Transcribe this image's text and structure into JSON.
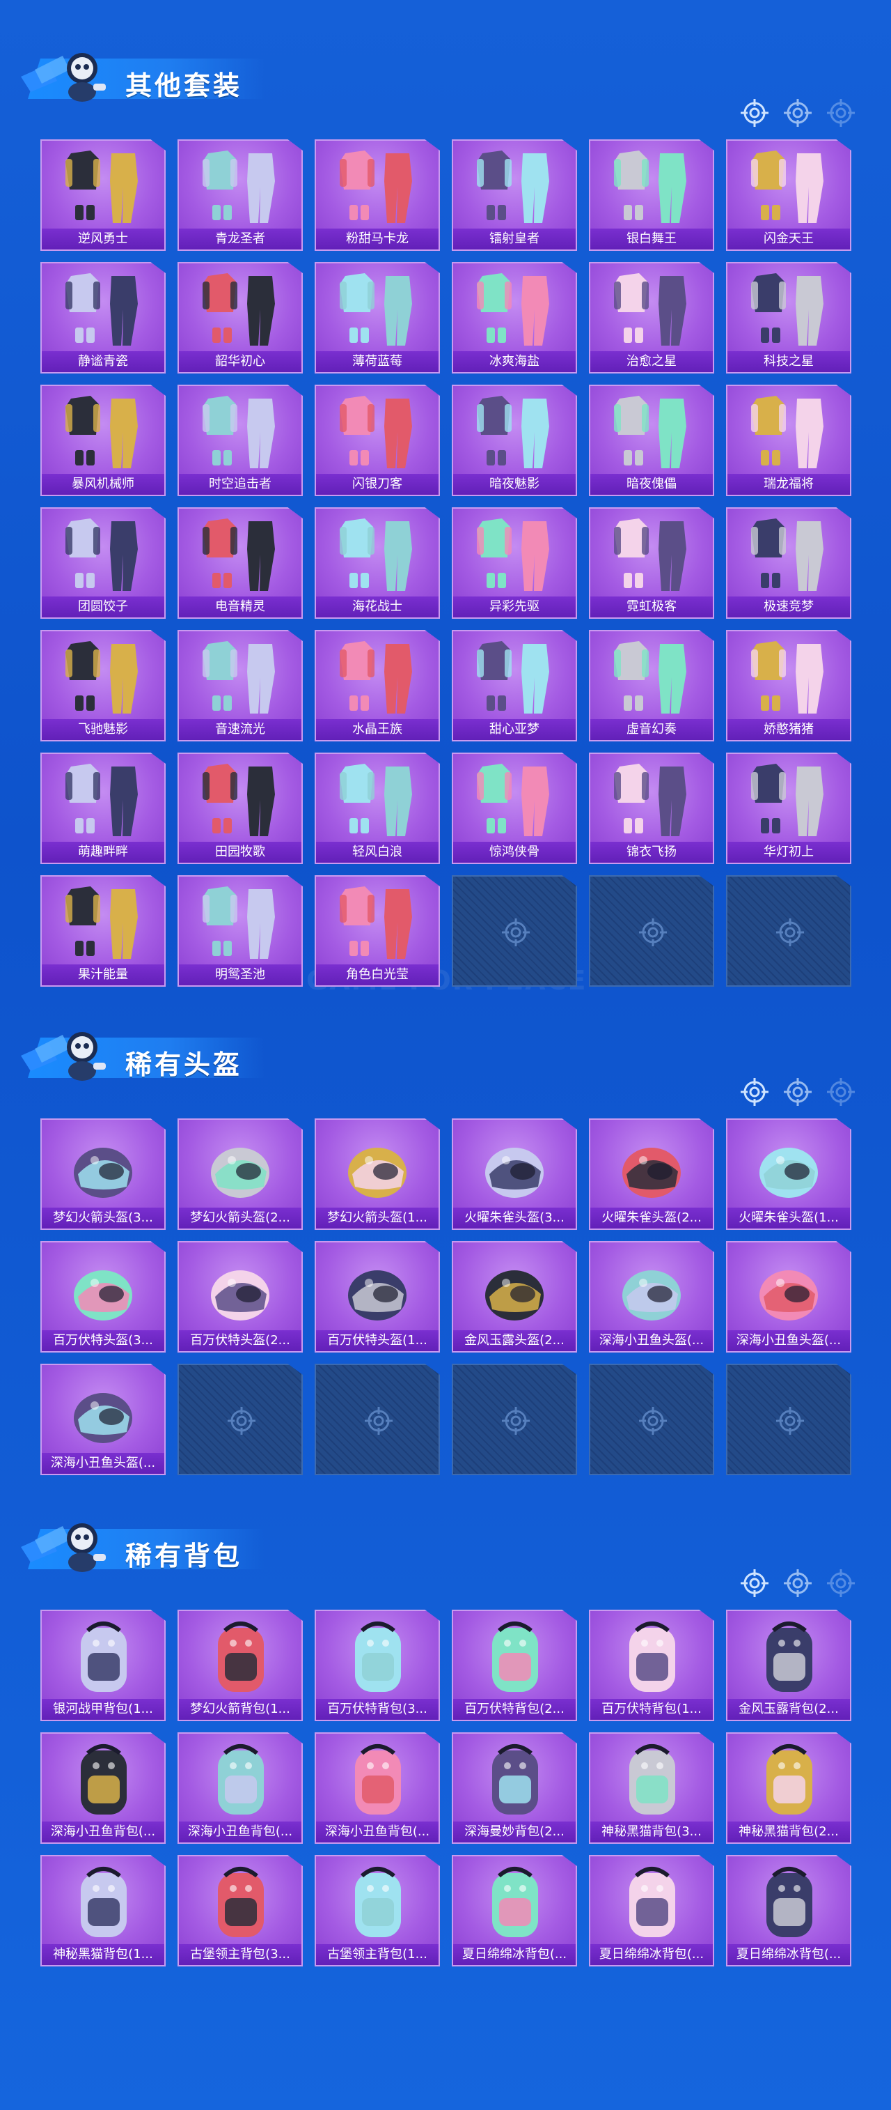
{
  "watermark": "GAME FOR PEACE",
  "sections": [
    {
      "title": "其他套装",
      "kind": "outfit",
      "items": [
        "逆风勇士",
        "青龙圣者",
        "粉甜马卡龙",
        "镭射皇者",
        "银白舞王",
        "闪金天王",
        "静谧青瓷",
        "韶华初心",
        "薄荷蓝莓",
        "冰爽海盐",
        "治愈之星",
        "科技之星",
        "暴风机械师",
        "时空追击者",
        "闪银刀客",
        "暗夜魅影",
        "暗夜傀儡",
        "瑞龙福将",
        "团圆饺子",
        "电音精灵",
        "海花战士",
        "异彩先驱",
        "霓虹极客",
        "极速竞梦",
        "飞驰魅影",
        "音速流光",
        "水晶王族",
        "甜心亚梦",
        "虚音幻奏",
        "娇憨猪猪",
        "萌趣畔畔",
        "田园牧歌",
        "轻风白浪",
        "惊鸿侠骨",
        "锦衣飞扬",
        "华灯初上",
        "果汁能量",
        "明鸳圣池",
        "角色白光莹"
      ],
      "empty_slots": 3
    },
    {
      "title": "稀有头盔",
      "kind": "helmet",
      "items": [
        "梦幻火箭头盔(3...",
        "梦幻火箭头盔(2...",
        "梦幻火箭头盔(1...",
        "火曜朱雀头盔(3...",
        "火曜朱雀头盔(2...",
        "火曜朱雀头盔(1...",
        "百万伏特头盔(3...",
        "百万伏特头盔(2...",
        "百万伏特头盔(1...",
        "金风玉露头盔(2...",
        "深海小丑鱼头盔(...",
        "深海小丑鱼头盔(...",
        "深海小丑鱼头盔(..."
      ],
      "empty_slots": 5
    },
    {
      "title": "稀有背包",
      "kind": "backpack",
      "items": [
        "银河战甲背包(1...",
        "梦幻火箭背包(1...",
        "百万伏特背包(3...",
        "百万伏特背包(2...",
        "百万伏特背包(1...",
        "金风玉露背包(2...",
        "深海小丑鱼背包(...",
        "深海小丑鱼背包(...",
        "深海小丑鱼背包(...",
        "深海曼妙背包(2...",
        "神秘黑猫背包(3...",
        "神秘黑猫背包(2...",
        "神秘黑猫背包(1...",
        "古堡领主背包(3...",
        "古堡领主背包(1...",
        "夏日绵绵冰背包(...",
        "夏日绵绵冰背包(...",
        "夏日绵绵冰背包(..."
      ],
      "empty_slots": 0
    }
  ],
  "colors": {
    "background": "#1560d8",
    "card": "#a45be3",
    "label_bar": "#6a24bf",
    "empty_slot": "#1d3f7a"
  }
}
